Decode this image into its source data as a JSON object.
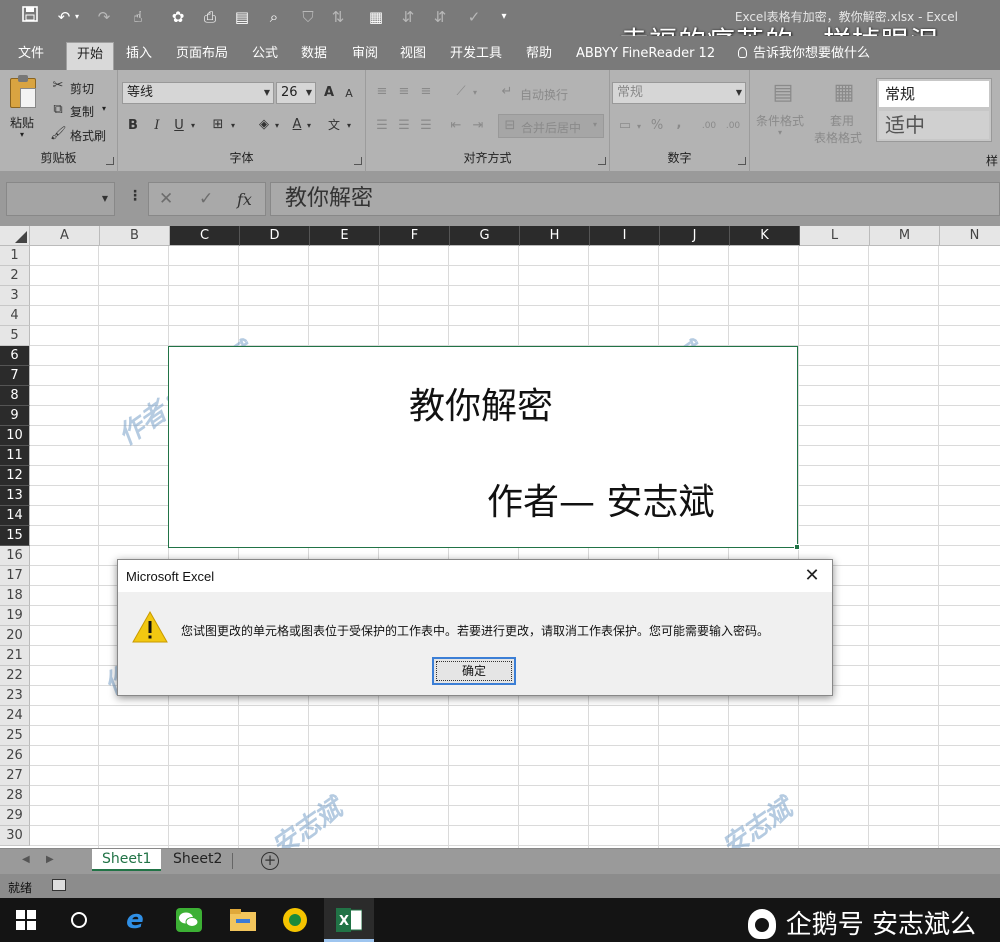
{
  "window": {
    "title": "Excel表格有加密，教你解密.xlsx  -  Excel",
    "overlay_caption": "幸福的痛苦的一样掉眼泪"
  },
  "quick_access": {
    "icons": [
      "save-icon",
      "undo-icon",
      "redo-icon",
      "touch-mode-icon",
      "wechat-icon",
      "print-preview-icon",
      "form-icon",
      "zoom-icon",
      "filter-icon",
      "sort-icon",
      "table-icon",
      "sort-asc-icon",
      "check-icon",
      "customize-icon"
    ]
  },
  "ribbon_tabs": [
    {
      "label": "文件"
    },
    {
      "label": "开始",
      "active": true
    },
    {
      "label": "插入"
    },
    {
      "label": "页面布局"
    },
    {
      "label": "公式"
    },
    {
      "label": "数据"
    },
    {
      "label": "审阅"
    },
    {
      "label": "视图"
    },
    {
      "label": "开发工具"
    },
    {
      "label": "帮助"
    },
    {
      "label": "ABBYY FineReader 12"
    },
    {
      "label": "告诉我你想要做什么"
    }
  ],
  "ribbon": {
    "clipboard": {
      "group_label": "剪贴板",
      "paste": "粘贴",
      "cut": "剪切",
      "copy": "复制",
      "format_painter": "格式刷"
    },
    "font": {
      "group_label": "字体",
      "font_name": "等线",
      "font_size": "26",
      "bold": "B",
      "italic": "I",
      "underline": "U",
      "grow": "A",
      "shrink": "A",
      "font_color": "A",
      "phonetic": "文"
    },
    "alignment": {
      "group_label": "对齐方式",
      "wrap_text": "自动换行",
      "merge_center": "合并后居中"
    },
    "number": {
      "group_label": "数字",
      "format": "常规",
      "percent": "%",
      "comma": ",",
      "inc_decimal": ".00",
      "dec_decimal": ".00"
    },
    "styles": {
      "conditional": "条件格式",
      "table_format_line1": "套用",
      "table_format_line2": "表格格式",
      "style_normal": "常规",
      "style_neutral": "适中",
      "group_label_partial": "样"
    }
  },
  "formula_bar": {
    "name_box": "",
    "cancel": "✕",
    "enter": "✓",
    "fx": "fx",
    "content": "教你解密"
  },
  "columns": [
    {
      "label": "A"
    },
    {
      "label": "B"
    },
    {
      "label": "C",
      "selected": true
    },
    {
      "label": "D",
      "selected": true
    },
    {
      "label": "E",
      "selected": true
    },
    {
      "label": "F",
      "selected": true
    },
    {
      "label": "G",
      "selected": true
    },
    {
      "label": "H",
      "selected": true
    },
    {
      "label": "I",
      "selected": true
    },
    {
      "label": "J",
      "selected": true
    },
    {
      "label": "K",
      "selected": true
    },
    {
      "label": "L"
    },
    {
      "label": "M"
    },
    {
      "label": "N"
    }
  ],
  "rows": [
    "1",
    "2",
    "3",
    "4",
    "5",
    "6",
    "7",
    "8",
    "9",
    "10",
    "11",
    "12",
    "13",
    "14",
    "15",
    "16",
    "17",
    "18",
    "19",
    "20",
    "21",
    "22",
    "23",
    "24",
    "25",
    "26",
    "27",
    "28",
    "29",
    "30"
  ],
  "selected_rows": [
    "6",
    "7",
    "8",
    "9",
    "10",
    "11",
    "12",
    "13",
    "14",
    "15"
  ],
  "merged_cell": {
    "line1": "教你解密",
    "line2": "作者— 安志斌"
  },
  "watermark": "作者：安志斌",
  "dialog": {
    "title": "Microsoft Excel",
    "message": "您试图更改的单元格或图表位于受保护的工作表中。若要进行更改，请取消工作表保护。您可能需要输入密码。",
    "ok_label": "确定",
    "close": "✕"
  },
  "sheets": [
    {
      "label": "Sheet1",
      "active": true
    },
    {
      "label": "Sheet2"
    }
  ],
  "add_sheet": "+",
  "status": {
    "text": "就绪"
  },
  "taskbar": {
    "excel_label": "X",
    "brand_text": "企鹅号 安志斌么"
  },
  "colors": {
    "excel_green": "#217346",
    "ribbon_gray": "#b3b3b3",
    "title_gray": "#7a7a7a",
    "taskbar": "#141414",
    "warning": "#f2c811"
  }
}
